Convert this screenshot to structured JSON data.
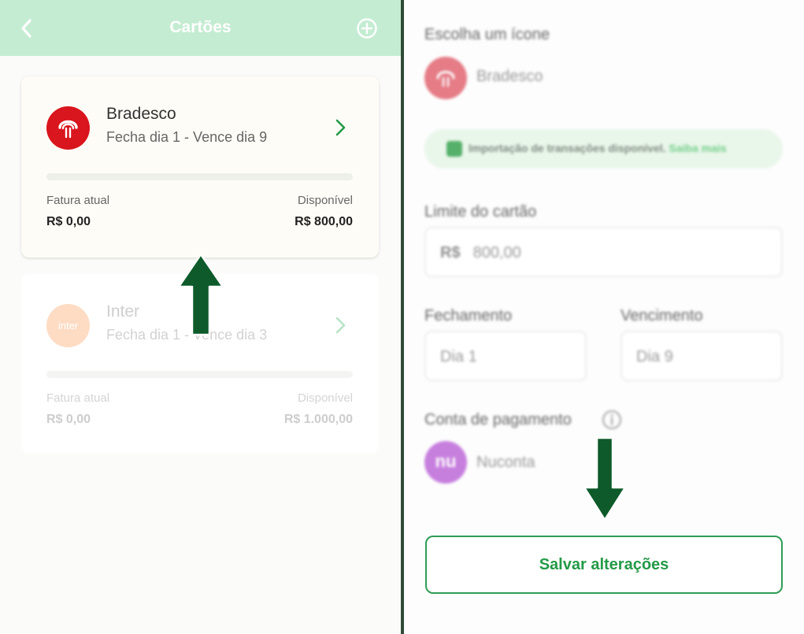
{
  "left_panel": {
    "header": {
      "title": "Cartões"
    },
    "cards": [
      {
        "name": "Bradesco",
        "dates": "Fecha dia 1 - Vence dia 9",
        "current_label": "Fatura atual",
        "current_value": "R$ 0,00",
        "available_label": "Disponível",
        "available_value": "R$ 800,00",
        "bar_used_fraction": 0
      },
      {
        "name": "Inter",
        "logo_text": "inter",
        "dates": "Fecha dia 1 - Vence dia 3",
        "current_label": "Fatura atual",
        "current_value": "R$ 0,00",
        "available_label": "Disponível",
        "available_value": "R$ 1.000,00",
        "bar_used_fraction": 0
      }
    ]
  },
  "right_panel": {
    "icon_label": "Escolha um ícone",
    "icon_name": "Bradesco",
    "banner": {
      "text": "Importação de transações disponível.",
      "link": "Saiba mais"
    },
    "limit_label": "Limite do cartão",
    "limit_currency": "R$",
    "limit_value": "800,00",
    "closing_label": "Fechamento",
    "closing_value": "Dia 1",
    "due_label": "Vencimento",
    "due_value": "Dia 9",
    "payment_label": "Conta de pagamento",
    "payment_logo_text": "nu",
    "payment_account": "Nuconta",
    "save_label": "Salvar alterações"
  },
  "colors": {
    "header_bg": "#c4ecd2",
    "accent_green": "#239a47",
    "bradesco_red": "#d9151d",
    "arrow_green": "#0e5a2a"
  },
  "icons": [
    "back-chevron-icon",
    "plus-circle-icon",
    "chevron-right-icon",
    "bradesco-logo-icon",
    "chart-icon",
    "info-icon",
    "arrow-up-icon",
    "arrow-down-icon"
  ]
}
